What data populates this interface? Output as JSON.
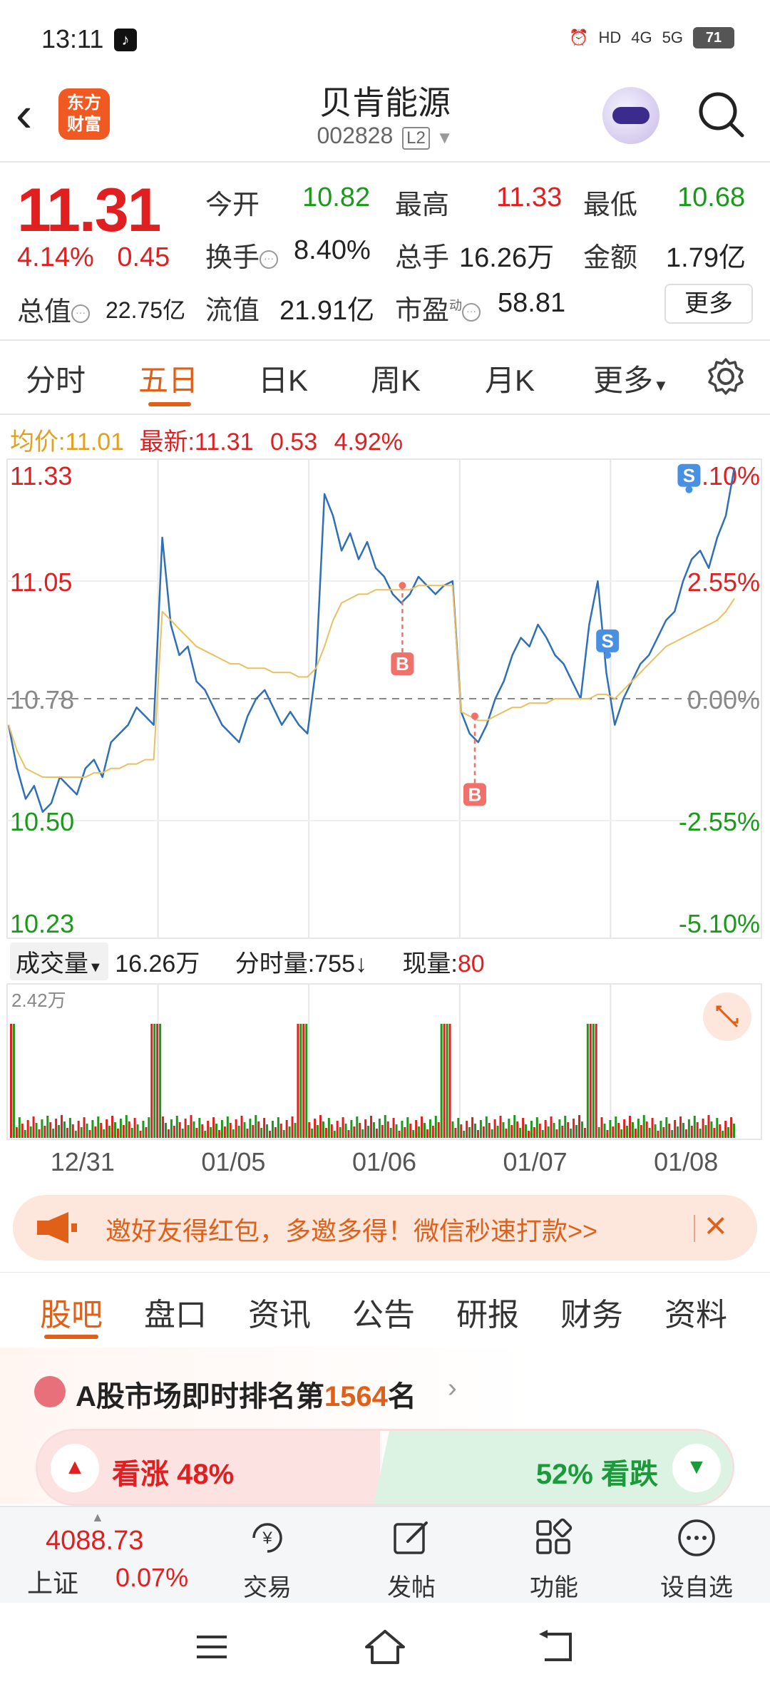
{
  "status_bar": {
    "time": "13:11",
    "battery": "71",
    "network_hd": "HD",
    "network_4g": "4G",
    "network_5g": "5G"
  },
  "header": {
    "logo_line1": "东方",
    "logo_line2": "财富",
    "title": "贝肯能源",
    "code": "002828",
    "level_badge": "L2"
  },
  "quote": {
    "price": "11.31",
    "change_pct": "4.14%",
    "change_abs": "0.45",
    "open_label": "今开",
    "open_value": "10.82",
    "high_label": "最高",
    "high_value": "11.33",
    "low_label": "最低",
    "low_value": "10.68",
    "turnover_label": "换手",
    "turnover_value": "8.40%",
    "volume_label": "总手",
    "volume_value": "16.26万",
    "amount_label": "金额",
    "amount_value": "1.79亿",
    "mktcap_label": "总值",
    "mktcap_value": "22.75亿",
    "float_label": "流值",
    "float_value": "21.91亿",
    "pe_label": "市盈",
    "pe_super": "动",
    "pe_value": "58.81",
    "more_button": "更多"
  },
  "chart_tabs": [
    "分时",
    "五日",
    "日K",
    "周K",
    "月K",
    "更多"
  ],
  "chart_tabs_active": 1,
  "avg_line": {
    "avg_label": "均价:",
    "avg_value": "11.01",
    "latest_label": "最新:",
    "latest_value": "11.31",
    "latest_change": "0.53",
    "latest_pct": "4.92%"
  },
  "volume_info": {
    "selector": "成交量",
    "total": "16.26万",
    "tick_label": "分时量:",
    "tick_value": "755",
    "tick_arrow": "↓",
    "now_label": "现量:",
    "now_value": "80",
    "max_label": "2.42万"
  },
  "chart_data": {
    "type": "line",
    "ylim": [
      10.23,
      11.33
    ],
    "y_left_ticks": [
      "11.33",
      "11.05",
      "10.78",
      "10.50",
      "10.23"
    ],
    "y_right_ticks": [
      "5.10%",
      "2.55%",
      "0.00%",
      "-2.55%",
      "-5.10%"
    ],
    "x_labels": [
      "12/31",
      "01/05",
      "01/06",
      "01/07",
      "01/08"
    ],
    "prev_close": 10.78,
    "series": [
      {
        "values": [
          10.72,
          10.62,
          10.55,
          10.58,
          10.52,
          10.54,
          10.6,
          10.58,
          10.56,
          10.62,
          10.64,
          10.6,
          10.68,
          10.7,
          10.72,
          10.76,
          10.74,
          10.72,
          11.15,
          10.95,
          10.88,
          10.9,
          10.82,
          10.8,
          10.76,
          10.72,
          10.7,
          10.68,
          10.74,
          10.78,
          10.8,
          10.76,
          10.72,
          10.75,
          10.72,
          10.7,
          10.85,
          11.25,
          11.2,
          11.12,
          11.16,
          11.1,
          11.14,
          11.08,
          11.06,
          11.02,
          11.0,
          11.02,
          11.06,
          11.04,
          11.02,
          11.04,
          11.05,
          10.75,
          10.7,
          10.68,
          10.72,
          10.78,
          10.82,
          10.88,
          10.92,
          10.9,
          10.95,
          10.92,
          10.88,
          10.86,
          10.82,
          10.78,
          10.95,
          11.05,
          10.84,
          10.72,
          10.78,
          10.82,
          10.86,
          10.88,
          10.92,
          10.96,
          10.98,
          11.05,
          11.1,
          11.12,
          11.08,
          11.15,
          11.2,
          11.31
        ]
      },
      {
        "values": [
          10.72,
          10.66,
          10.62,
          10.61,
          10.6,
          10.6,
          10.6,
          10.6,
          10.6,
          10.6,
          10.61,
          10.61,
          10.62,
          10.62,
          10.63,
          10.63,
          10.64,
          10.64,
          10.98,
          10.96,
          10.94,
          10.92,
          10.9,
          10.89,
          10.88,
          10.87,
          10.86,
          10.86,
          10.85,
          10.85,
          10.85,
          10.84,
          10.84,
          10.84,
          10.83,
          10.83,
          10.85,
          10.9,
          10.96,
          11.0,
          11.01,
          11.02,
          11.02,
          11.03,
          11.03,
          11.03,
          11.03,
          11.03,
          11.04,
          11.04,
          11.04,
          11.04,
          11.04,
          10.75,
          10.74,
          10.73,
          10.73,
          10.74,
          10.75,
          10.76,
          10.76,
          10.77,
          10.77,
          10.77,
          10.78,
          10.78,
          10.78,
          10.78,
          10.78,
          10.79,
          10.79,
          10.78,
          10.8,
          10.82,
          10.84,
          10.86,
          10.88,
          10.9,
          10.91,
          10.92,
          10.93,
          10.94,
          10.95,
          10.96,
          10.98,
          11.01
        ]
      }
    ],
    "markers": [
      {
        "label": "B",
        "date_index": 2,
        "value": 11.04
      },
      {
        "label": "B",
        "date_index": 3,
        "value": 10.74
      },
      {
        "label": "S",
        "date_index": 3,
        "value": 10.88
      },
      {
        "label": "S",
        "date_index": 4,
        "value": 11.26
      }
    ]
  },
  "banner": {
    "text": "邀好友得红包，多邀多得！微信秒速打款>>"
  },
  "sub_tabs": [
    "股吧",
    "盘口",
    "资讯",
    "公告",
    "研报",
    "财务",
    "资料"
  ],
  "rank": {
    "prefix": "A股市场即时排名第",
    "number": "1564",
    "suffix": "名"
  },
  "vote": {
    "up_label": "看涨",
    "up_pct": "48%",
    "down_pct": "52%",
    "down_label": "看跌"
  },
  "bottom_bar": {
    "index_value": "4088.73",
    "index_name": "上证",
    "index_pct": "0.07%",
    "items": [
      "交易",
      "发帖",
      "功能",
      "设自选"
    ]
  },
  "colors": {
    "up": "#e02020",
    "down": "#1a9a1a",
    "accent": "#e0601a",
    "price_line": "#2f6fb8",
    "avg_line": "#e8c060"
  }
}
